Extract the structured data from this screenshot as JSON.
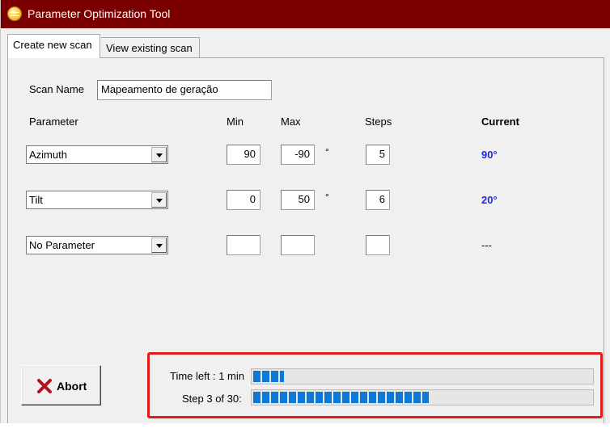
{
  "window": {
    "title": "Parameter Optimization Tool",
    "icon": "app-logo-icon"
  },
  "tabs": [
    {
      "label": "Create new scan",
      "active": true
    },
    {
      "label": "View existing scan",
      "active": false
    }
  ],
  "form": {
    "scan_name_label": "Scan Name",
    "scan_name_value": "Mapeamento de geração",
    "headers": {
      "parameter": "Parameter",
      "min": "Min",
      "max": "Max",
      "steps": "Steps",
      "current": "Current"
    },
    "rows": [
      {
        "parameter": "Azimuth",
        "min": "90",
        "max": "-90",
        "unit": "°",
        "steps": "5",
        "current": "90°"
      },
      {
        "parameter": "Tilt",
        "min": "0",
        "max": "50",
        "unit": "°",
        "steps": "6",
        "current": "20°"
      },
      {
        "parameter": "No Parameter",
        "min": "",
        "max": "",
        "unit": "",
        "steps": "",
        "current": "---"
      }
    ]
  },
  "abort": {
    "label": "Abort",
    "icon": "x-icon"
  },
  "progress": {
    "time_left_label": "Time left : 1 min",
    "time_left_fraction": 0.09,
    "step_label": "Step 3 of 30:",
    "step_fraction": 0.52
  },
  "colors": {
    "titlebar": "#7a0000",
    "current_value": "#1f28e0",
    "progress_fill": "#0f77d6",
    "highlight_frame": "#e21b1b",
    "abort_x": "#b0131d"
  }
}
